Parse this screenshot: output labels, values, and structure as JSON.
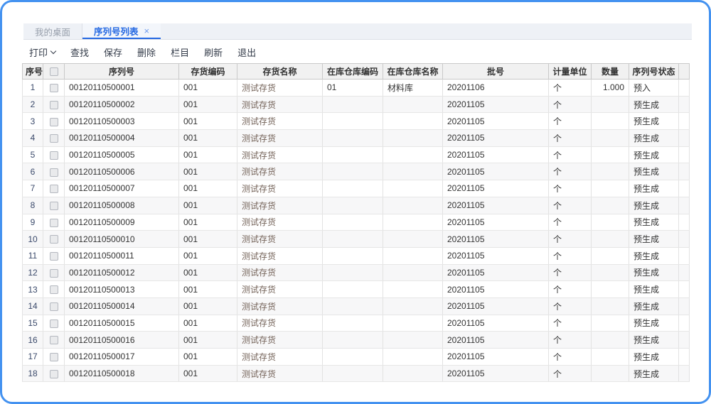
{
  "window": {
    "frame_color": "#4492f0",
    "accent_blue": "#2267e2"
  },
  "tabs": [
    {
      "label": "我的桌面",
      "active": false
    },
    {
      "label": "序列号列表",
      "active": true,
      "close_icon": "×"
    }
  ],
  "toolbar": {
    "items": [
      {
        "label": "打印",
        "dropdown": true
      },
      {
        "label": "查找"
      },
      {
        "label": "保存"
      },
      {
        "label": "删除"
      },
      {
        "label": "栏目"
      },
      {
        "label": "刷新"
      },
      {
        "label": "退出"
      }
    ]
  },
  "table": {
    "columns": [
      "序号",
      "",
      "序列号",
      "存货编码",
      "存货名称",
      "在库仓库编码",
      "在库仓库名称",
      "批号",
      "计量单位",
      "数量",
      "序列号状态",
      ""
    ],
    "rows": [
      {
        "no": 1,
        "serial": "00120110500001",
        "inv_code": "001",
        "inv_name": "测试存货",
        "wh_code": "01",
        "wh_name": "材料库",
        "batch": "20201106",
        "unit": "个",
        "qty": "1.000",
        "status": "预入"
      },
      {
        "no": 2,
        "serial": "00120110500002",
        "inv_code": "001",
        "inv_name": "测试存货",
        "wh_code": "",
        "wh_name": "",
        "batch": "20201105",
        "unit": "个",
        "qty": "",
        "status": "预生成"
      },
      {
        "no": 3,
        "serial": "00120110500003",
        "inv_code": "001",
        "inv_name": "测试存货",
        "wh_code": "",
        "wh_name": "",
        "batch": "20201105",
        "unit": "个",
        "qty": "",
        "status": "预生成"
      },
      {
        "no": 4,
        "serial": "00120110500004",
        "inv_code": "001",
        "inv_name": "测试存货",
        "wh_code": "",
        "wh_name": "",
        "batch": "20201105",
        "unit": "个",
        "qty": "",
        "status": "预生成"
      },
      {
        "no": 5,
        "serial": "00120110500005",
        "inv_code": "001",
        "inv_name": "测试存货",
        "wh_code": "",
        "wh_name": "",
        "batch": "20201105",
        "unit": "个",
        "qty": "",
        "status": "预生成"
      },
      {
        "no": 6,
        "serial": "00120110500006",
        "inv_code": "001",
        "inv_name": "测试存货",
        "wh_code": "",
        "wh_name": "",
        "batch": "20201105",
        "unit": "个",
        "qty": "",
        "status": "预生成"
      },
      {
        "no": 7,
        "serial": "00120110500007",
        "inv_code": "001",
        "inv_name": "测试存货",
        "wh_code": "",
        "wh_name": "",
        "batch": "20201105",
        "unit": "个",
        "qty": "",
        "status": "预生成"
      },
      {
        "no": 8,
        "serial": "00120110500008",
        "inv_code": "001",
        "inv_name": "测试存货",
        "wh_code": "",
        "wh_name": "",
        "batch": "20201105",
        "unit": "个",
        "qty": "",
        "status": "预生成"
      },
      {
        "no": 9,
        "serial": "00120110500009",
        "inv_code": "001",
        "inv_name": "测试存货",
        "wh_code": "",
        "wh_name": "",
        "batch": "20201105",
        "unit": "个",
        "qty": "",
        "status": "预生成"
      },
      {
        "no": 10,
        "serial": "00120110500010",
        "inv_code": "001",
        "inv_name": "测试存货",
        "wh_code": "",
        "wh_name": "",
        "batch": "20201105",
        "unit": "个",
        "qty": "",
        "status": "预生成"
      },
      {
        "no": 11,
        "serial": "00120110500011",
        "inv_code": "001",
        "inv_name": "测试存货",
        "wh_code": "",
        "wh_name": "",
        "batch": "20201105",
        "unit": "个",
        "qty": "",
        "status": "预生成"
      },
      {
        "no": 12,
        "serial": "00120110500012",
        "inv_code": "001",
        "inv_name": "测试存货",
        "wh_code": "",
        "wh_name": "",
        "batch": "20201105",
        "unit": "个",
        "qty": "",
        "status": "预生成"
      },
      {
        "no": 13,
        "serial": "00120110500013",
        "inv_code": "001",
        "inv_name": "测试存货",
        "wh_code": "",
        "wh_name": "",
        "batch": "20201105",
        "unit": "个",
        "qty": "",
        "status": "预生成"
      },
      {
        "no": 14,
        "serial": "00120110500014",
        "inv_code": "001",
        "inv_name": "测试存货",
        "wh_code": "",
        "wh_name": "",
        "batch": "20201105",
        "unit": "个",
        "qty": "",
        "status": "预生成"
      },
      {
        "no": 15,
        "serial": "00120110500015",
        "inv_code": "001",
        "inv_name": "测试存货",
        "wh_code": "",
        "wh_name": "",
        "batch": "20201105",
        "unit": "个",
        "qty": "",
        "status": "预生成"
      },
      {
        "no": 16,
        "serial": "00120110500016",
        "inv_code": "001",
        "inv_name": "测试存货",
        "wh_code": "",
        "wh_name": "",
        "batch": "20201105",
        "unit": "个",
        "qty": "",
        "status": "预生成"
      },
      {
        "no": 17,
        "serial": "00120110500017",
        "inv_code": "001",
        "inv_name": "测试存货",
        "wh_code": "",
        "wh_name": "",
        "batch": "20201105",
        "unit": "个",
        "qty": "",
        "status": "预生成"
      },
      {
        "no": 18,
        "serial": "00120110500018",
        "inv_code": "001",
        "inv_name": "测试存货",
        "wh_code": "",
        "wh_name": "",
        "batch": "20201105",
        "unit": "个",
        "qty": "",
        "status": "预生成"
      }
    ]
  }
}
